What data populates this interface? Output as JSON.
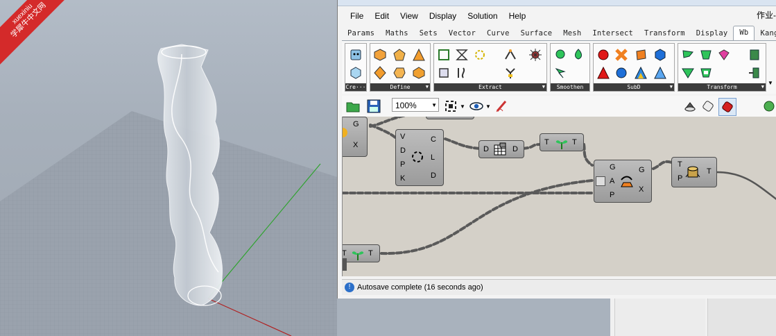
{
  "watermark": {
    "line1": "xuexiniu",
    "line2": "学犀牛中文网"
  },
  "window": {
    "title_fragment": "作业-"
  },
  "menu": [
    "File",
    "Edit",
    "View",
    "Display",
    "Solution",
    "Help"
  ],
  "tabs": [
    "Params",
    "Maths",
    "Sets",
    "Vector",
    "Curve",
    "Surface",
    "Mesh",
    "Intersect",
    "Transform",
    "Display",
    "Wb",
    "Kangaroo"
  ],
  "active_tab": "Wb",
  "ribbon_groups": [
    {
      "label": "Cre···"
    },
    {
      "label": "Define"
    },
    {
      "label": "Extract"
    },
    {
      "label": "Smoothen"
    },
    {
      "label": "SubD"
    },
    {
      "label": "Transform"
    }
  ],
  "toolbar": {
    "zoom": "100%"
  },
  "nodes": {
    "left_partial": {
      "inputs": [
        "G",
        "X"
      ]
    },
    "vertex": {
      "inputs": [
        "V",
        "D",
        "P",
        "K"
      ],
      "outputs": [
        "C",
        "L",
        "D"
      ]
    },
    "mesh": {
      "input": "D",
      "output": "D"
    },
    "tree1": {
      "input": "T",
      "output": "T"
    },
    "transform": {
      "inputs": [
        "G",
        "A",
        "P"
      ],
      "outputs": [
        "G",
        "X"
      ]
    },
    "stump": {
      "inputs": [
        "T",
        "P"
      ],
      "output": "T"
    },
    "tree2": {
      "input": "T",
      "output": "T"
    }
  },
  "status": {
    "text": "Autosave complete (16 seconds ago)"
  },
  "colors": {
    "watermark_red": "#d42a2a",
    "status_blue": "#2b6fc9",
    "canvas_bg": "#d4d0c8"
  }
}
